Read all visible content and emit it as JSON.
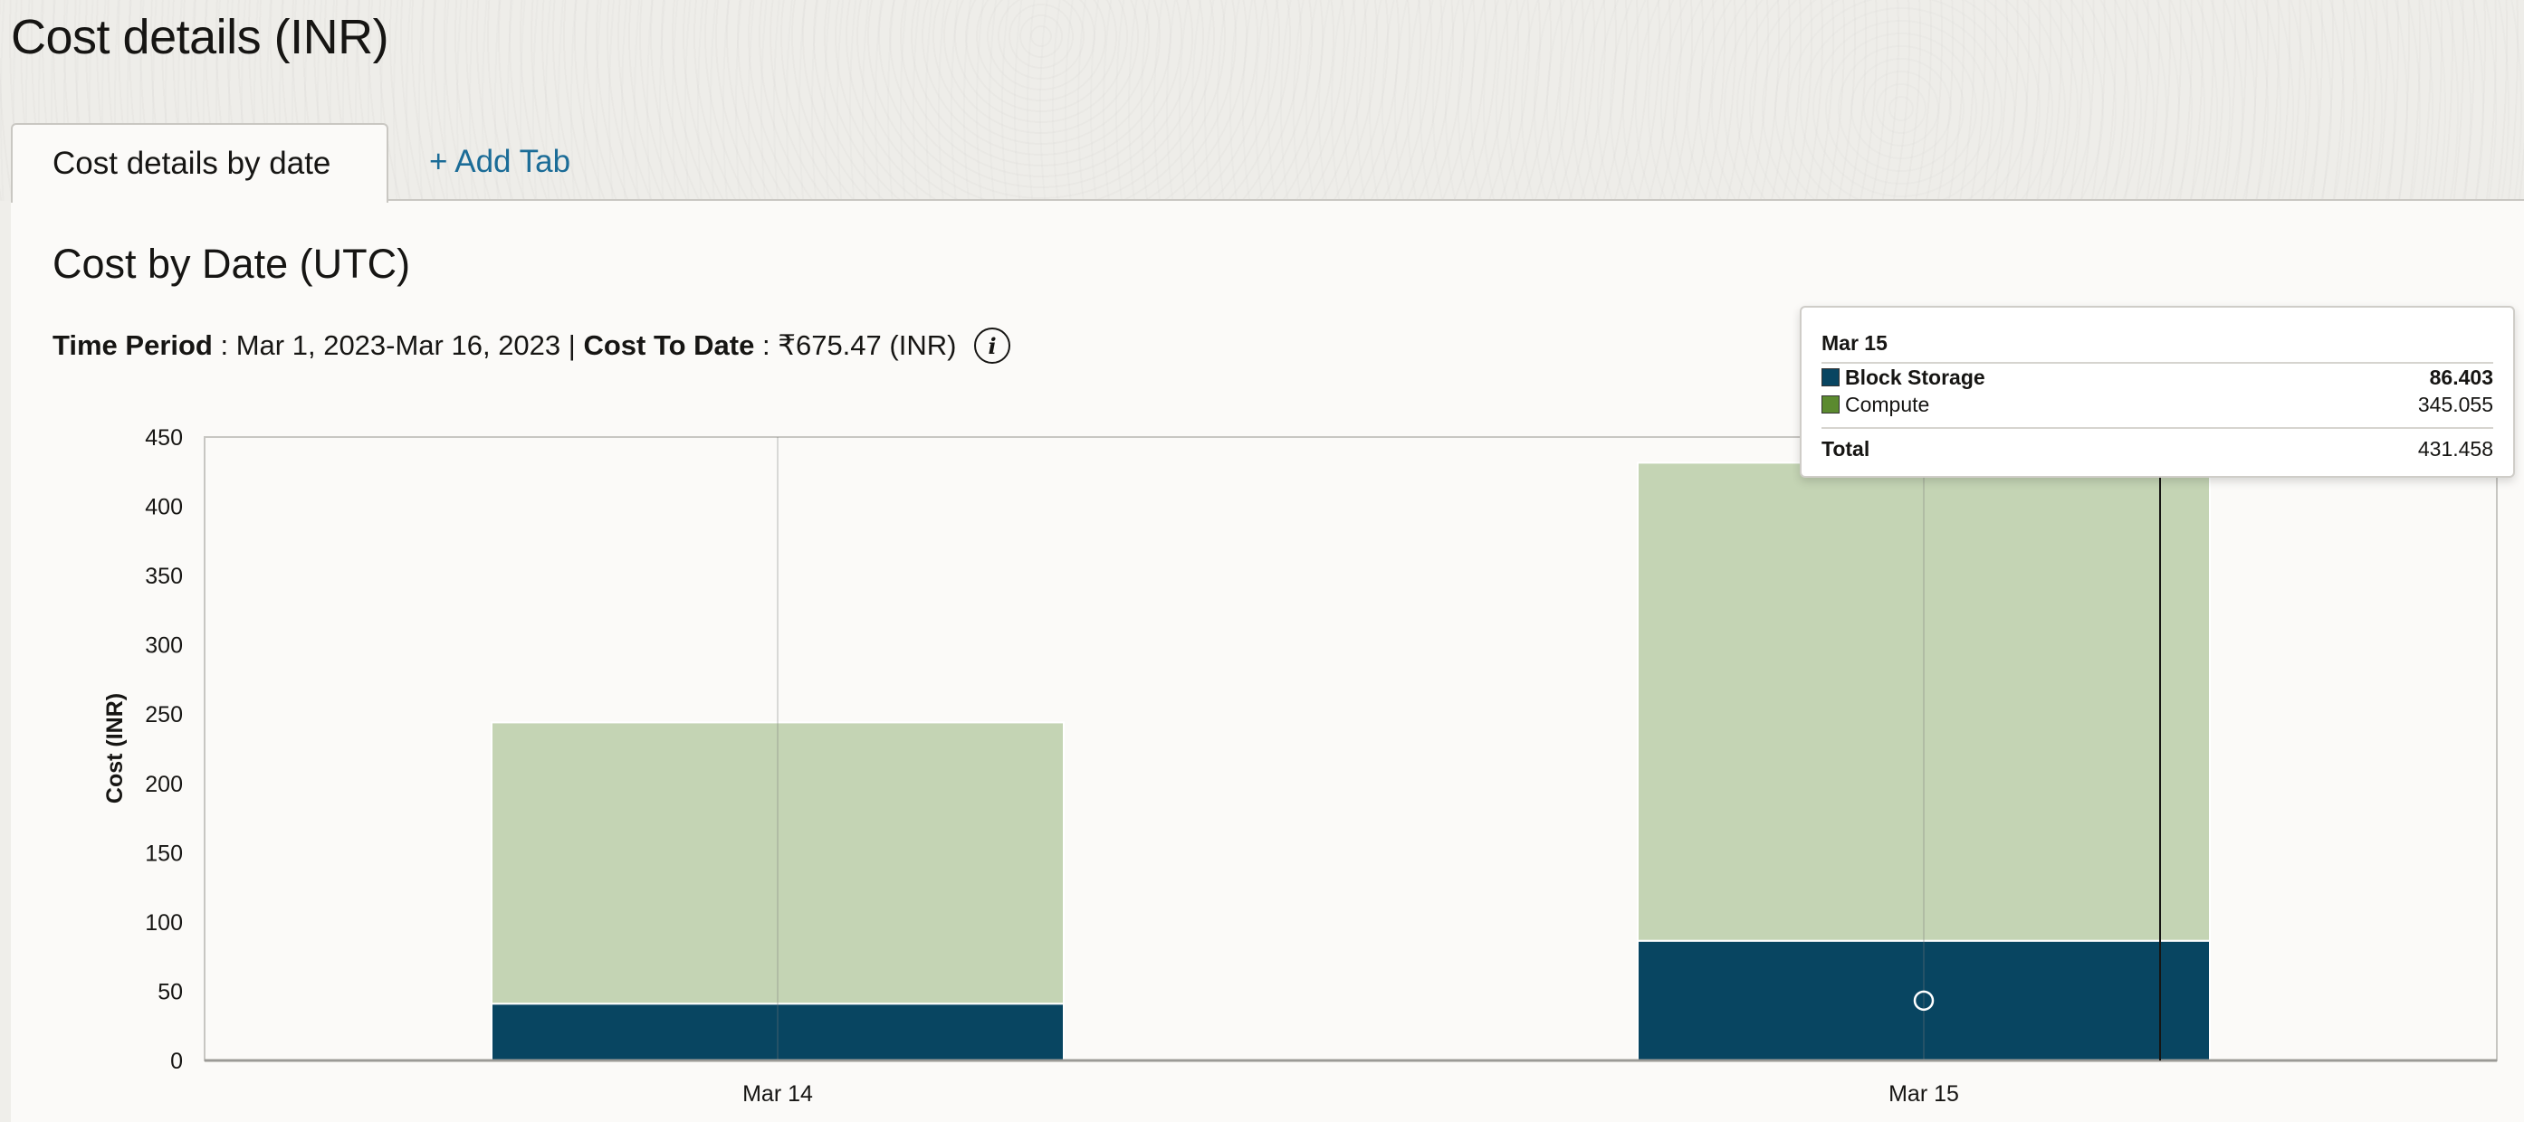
{
  "page": {
    "title": "Cost details (INR)"
  },
  "tabs": [
    {
      "label": "Cost details by date",
      "active": true
    },
    {
      "label": "+ Add Tab"
    }
  ],
  "section": {
    "title": "Cost by Date (UTC)",
    "time_period_label": "Time Period",
    "time_period_value": "Mar 1, 2023-Mar 16, 2023",
    "separator": "|",
    "cost_to_date_label": "Cost To Date",
    "cost_to_date_value": "₹675.47 (INR)",
    "info_icon": "i"
  },
  "colors": {
    "block_storage": "#084561",
    "compute_light": "#c4d4b4",
    "compute_legend": "#5b8a2f",
    "link": "#1b6c97"
  },
  "chart_data": {
    "type": "bar",
    "stacked": true,
    "categories": [
      "Mar 14",
      "Mar 15"
    ],
    "series": [
      {
        "name": "Block Storage",
        "values": [
          41,
          86.403
        ]
      },
      {
        "name": "Compute",
        "values": [
          203,
          345.055
        ]
      }
    ],
    "ylabel": "Cost (INR)",
    "xlabel": "",
    "ylim": [
      0,
      450
    ],
    "yticks": [
      0,
      50,
      100,
      150,
      200,
      250,
      300,
      350,
      400,
      450
    ],
    "grid": false
  },
  "tooltip": {
    "date": "Mar 15",
    "rows": [
      {
        "name": "Block Storage",
        "value": "86.403",
        "bold": true,
        "color": "#084561"
      },
      {
        "name": "Compute",
        "value": "345.055",
        "bold": false,
        "color": "#5b8a2f"
      }
    ],
    "total_label": "Total",
    "total_value": "431.458"
  }
}
